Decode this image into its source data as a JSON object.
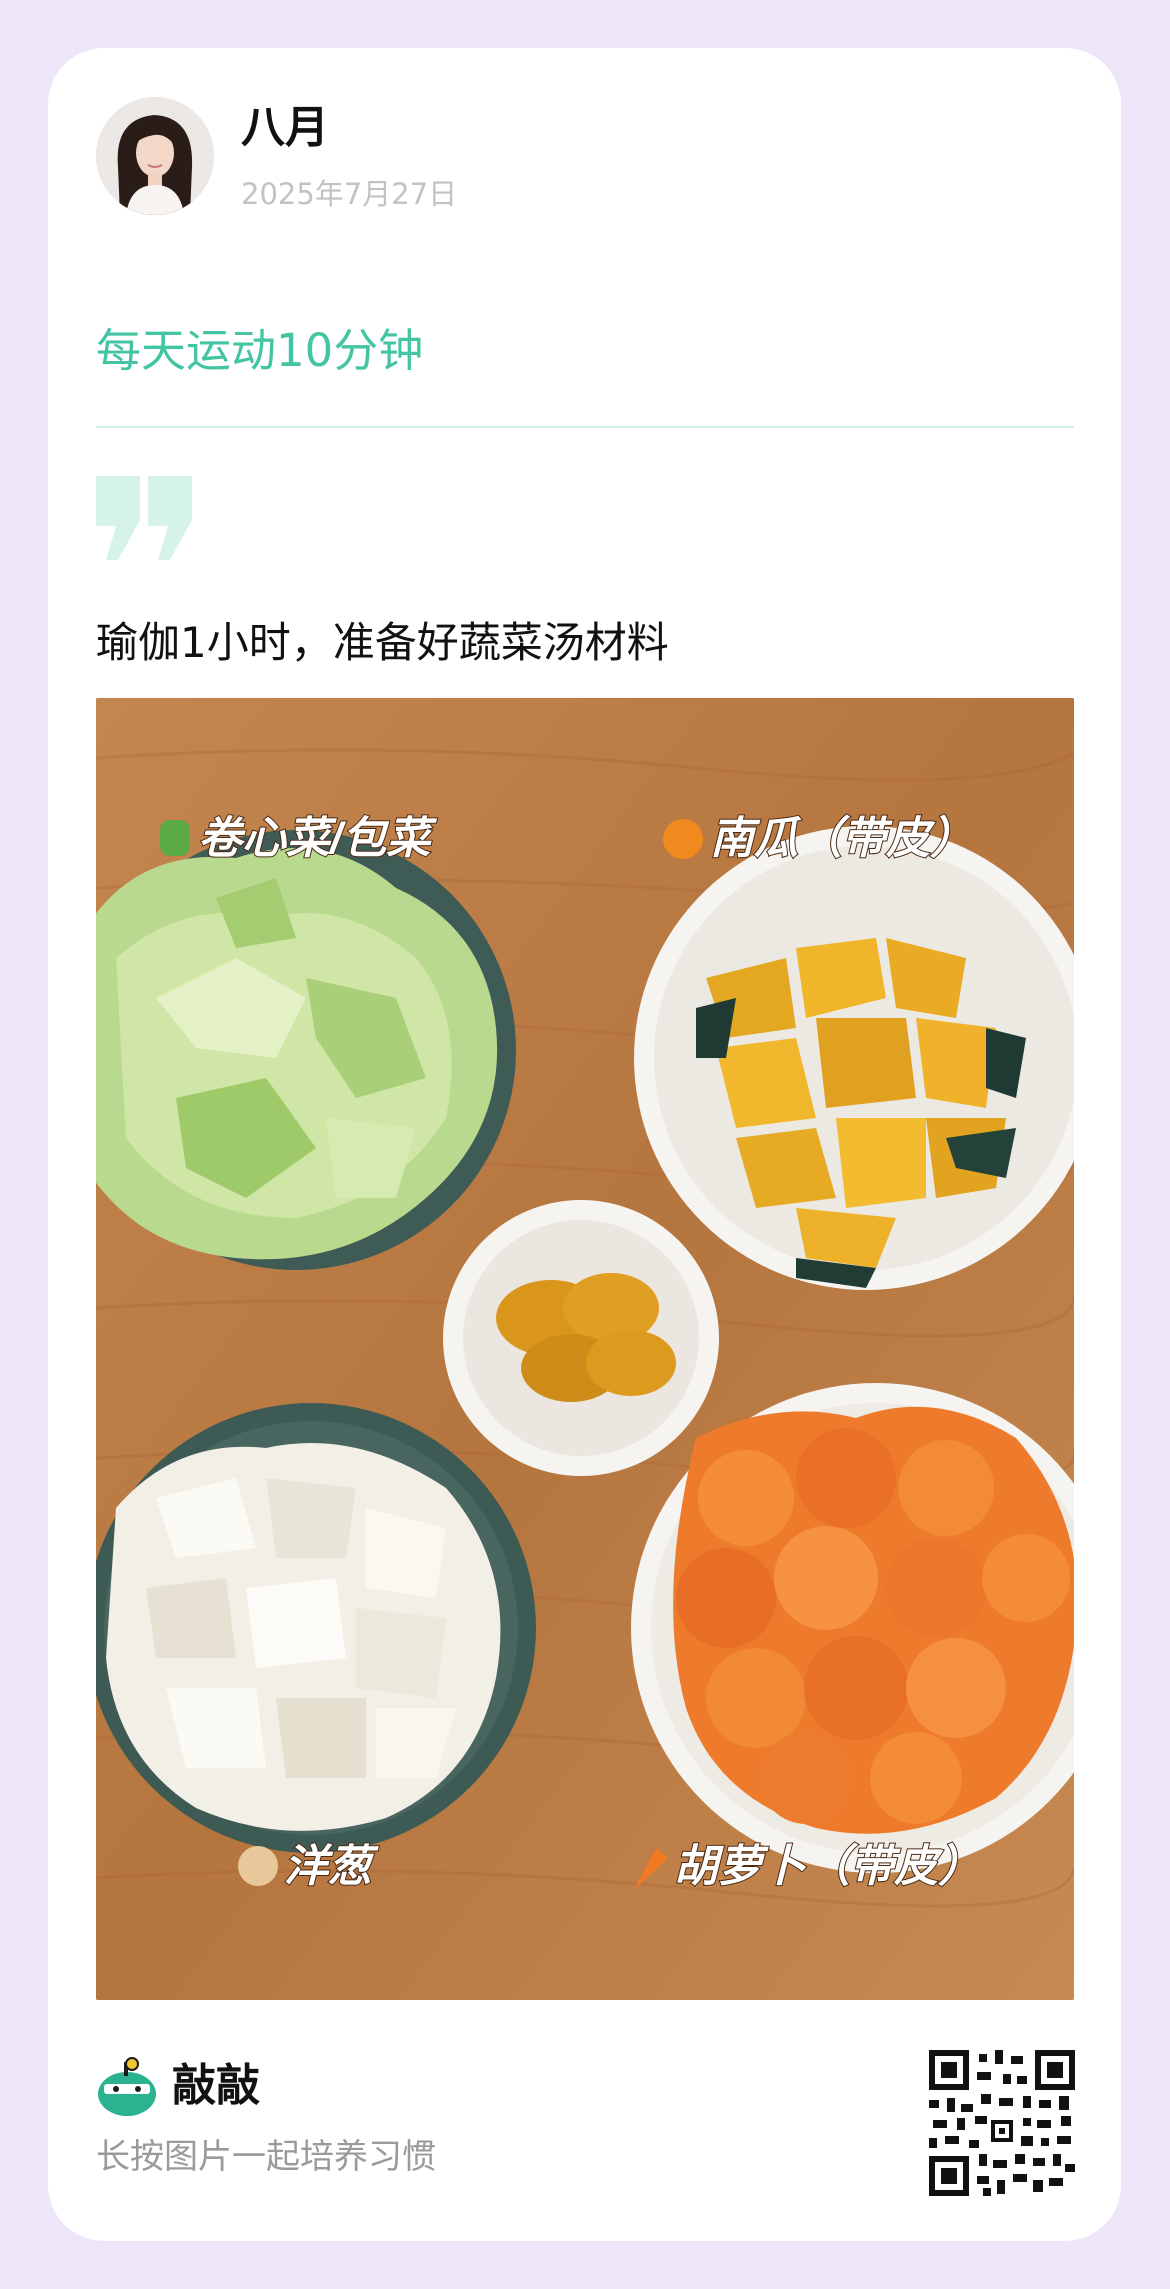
{
  "user": {
    "name": "八月",
    "date": "2025年7月27日"
  },
  "habit": {
    "title": "每天运动10分钟"
  },
  "post": {
    "text": "瑜伽1小时，准备好蔬菜汤材料"
  },
  "photo": {
    "labels": {
      "cabbage": "卷心菜/包菜",
      "pumpkin": "南瓜（带皮）",
      "onion": "洋葱",
      "carrot": "胡萝卜（带皮）"
    },
    "label_icons": {
      "cabbage": "leafy-green-emoji",
      "pumpkin": "jack-o-lantern-emoji",
      "onion": "onion-emoji",
      "carrot": "carrot-emoji"
    }
  },
  "footer": {
    "brand_name": "敲敲",
    "slogan": "长按图片一起培养习惯",
    "brand_icon": "mascot-icon",
    "qr_icon": "qr-code"
  },
  "colors": {
    "accent": "#43c4a3",
    "background": "#ece6f8",
    "card": "#ffffff",
    "divider": "#d2efe6"
  }
}
